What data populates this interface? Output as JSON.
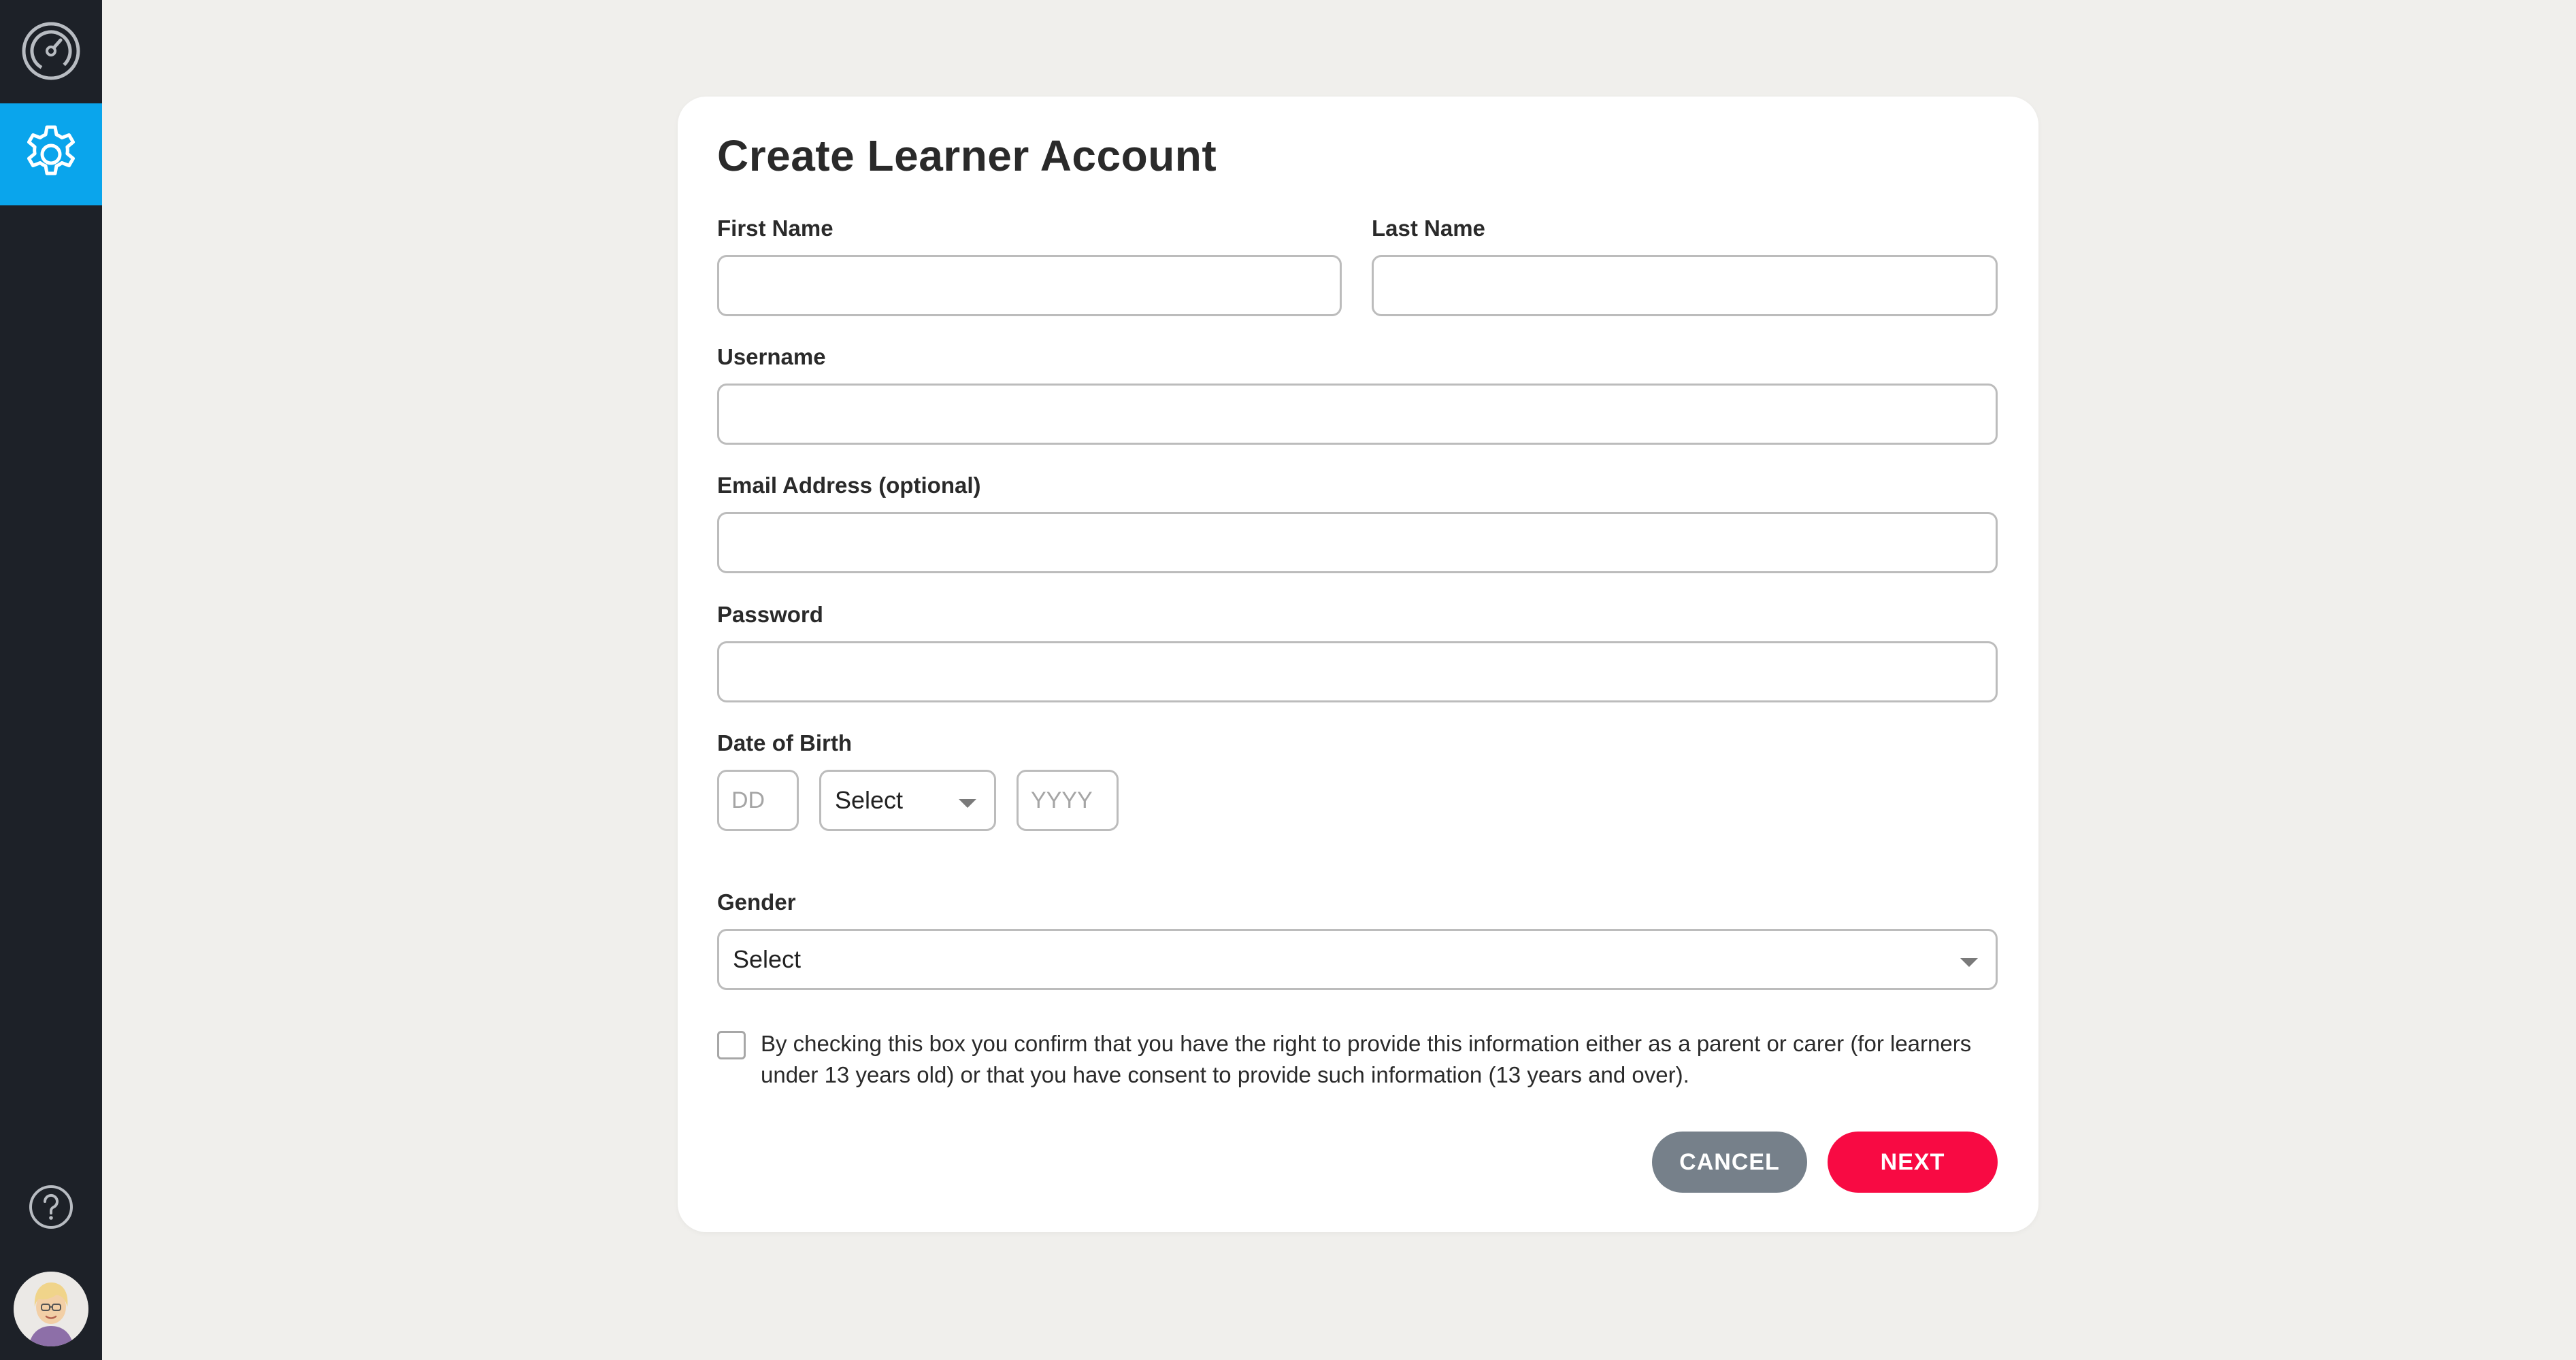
{
  "sidebar": {
    "items": [
      {
        "name": "dashboard",
        "icon": "speedometer-icon",
        "active": false
      },
      {
        "name": "settings",
        "icon": "gear-icon",
        "active": true
      }
    ],
    "help_icon": "help-icon",
    "avatar_icon": "user-avatar",
    "accent_color": "#0aa5ec",
    "background_color": "#1d2128"
  },
  "form": {
    "title": "Create Learner Account",
    "first_name": {
      "label": "First Name",
      "value": ""
    },
    "last_name": {
      "label": "Last Name",
      "value": ""
    },
    "username": {
      "label": "Username",
      "value": ""
    },
    "email": {
      "label": "Email Address (optional)",
      "value": ""
    },
    "password": {
      "label": "Password",
      "value": ""
    },
    "dob": {
      "label": "Date of Birth",
      "day_placeholder": "DD",
      "month_value": "Select",
      "year_placeholder": "YYYY"
    },
    "gender": {
      "label": "Gender",
      "value": "Select"
    },
    "consent": {
      "checked": false,
      "text": "By checking this box you confirm that you have the right to provide this information either as a parent or carer (for learners under 13 years old) or that you have consent to provide such information (13 years and over)."
    },
    "buttons": {
      "cancel": "CANCEL",
      "next": "NEXT",
      "cancel_color": "#76808a",
      "next_color": "#f80a43"
    }
  }
}
